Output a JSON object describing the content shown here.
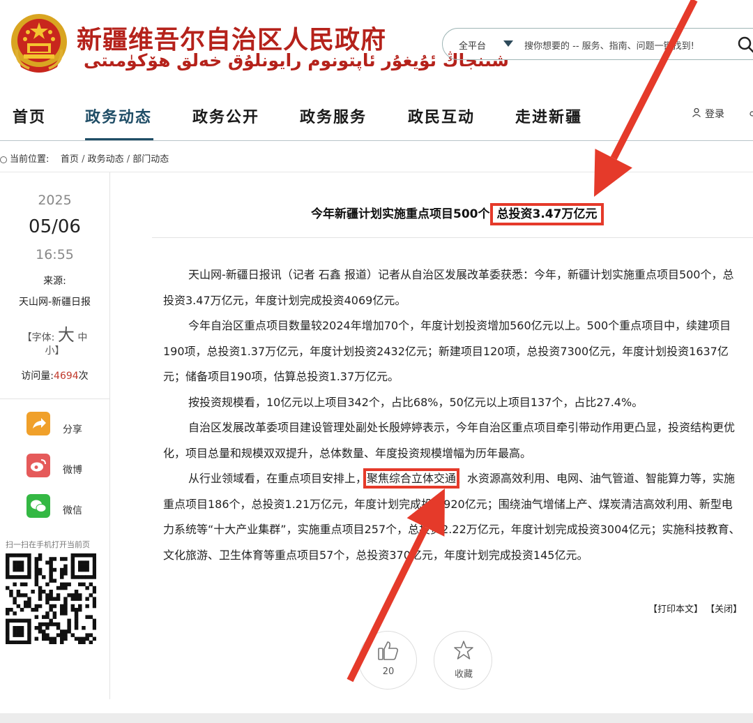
{
  "header": {
    "site_name_cn": "新疆维吾尔自治区人民政府",
    "site_name_ug": "شىنجاڭ ئۇيغۇر ئاپتونوم رايونلۇق خەلق ھۆكۈمىتى",
    "search": {
      "scope": "全平台",
      "placeholder": "搜你想要的 -- 服务、指南、问题一键找到!"
    },
    "login": "登录"
  },
  "nav": {
    "items": [
      "首页",
      "政务动态",
      "政务公开",
      "政务服务",
      "政民互动",
      "走进新疆"
    ],
    "active_index": 1
  },
  "breadcrumb": {
    "label": "当前位置:",
    "items": [
      "首页",
      "政务动态",
      "部门动态"
    ]
  },
  "sidebar": {
    "year": "2025",
    "month_day": "05/06",
    "time": "16:55",
    "source_label": "来源:",
    "source_value": "天山网-新疆日报",
    "font_label": "【字体:",
    "font_big": "大",
    "font_medium": "中",
    "font_small": "小】",
    "visits_label": "访问量:",
    "visits_count": "4694",
    "visits_unit": "次",
    "share": [
      {
        "label": "分享",
        "icon": "share-icon",
        "color": "#f0a02a"
      },
      {
        "label": "微博",
        "icon": "weibo-icon",
        "color": "#e55a5a"
      },
      {
        "label": "微信",
        "icon": "wechat-icon",
        "color": "#34b844"
      }
    ],
    "qr_caption": "扫一扫在手机打开当前页"
  },
  "article": {
    "title_prefix": "今年新疆计划实施重点项目500个",
    "title_highlight": "总投资3.47万亿元",
    "paragraphs": [
      "天山网-新疆日报讯（记者 石鑫 报道）记者从自治区发展改革委获悉：今年，新疆计划实施重点项目500个，总投资3.47万亿元，年度计划完成投资4069亿元。",
      "今年自治区重点项目数量较2024年增加70个，年度计划投资增加560亿元以上。500个重点项目中，续建项目190项，总投资1.37万亿元，年度计划投资2432亿元；新建项目120项，总投资7300亿元，年度计划投资1637亿元；储备项目190项，估算总投资1.37万亿元。",
      "按投资规模看，10亿元以上项目342个，占比68%，50亿元以上项目137个，占比27.4%。",
      "自治区发展改革委项目建设管理处副处长殷婷婷表示，今年自治区重点项目牵引带动作用更凸显，投资结构更优化，项目总量和规模双双提升，总体数量、年度投资规模增幅为历年最高。"
    ],
    "p5_before": "从行业领域看，在重点项目安排上，",
    "p5_highlight": "聚焦综合立体交通",
    "p5_after": "、水资源高效利用、电网、油气管道、智能算力等，实施重点项目186个，总投资1.21万亿元，年度计划完成投资920亿元；围绕油气增储上产、煤炭清洁高效利用、新型电力系统等“十大产业集群”，实施重点项目257个，总投资2.22万亿元，年度计划完成投资3004亿元；实施科技教育、文化旅游、卫生体育等重点项目57个，总投资370亿元，年度计划完成投资145亿元。",
    "print_label": "【打印本文】",
    "close_label": "【关闭】",
    "like_count": "20",
    "favorite_label": "收藏"
  },
  "annotations": {
    "arrow_color": "#e53a2a"
  }
}
